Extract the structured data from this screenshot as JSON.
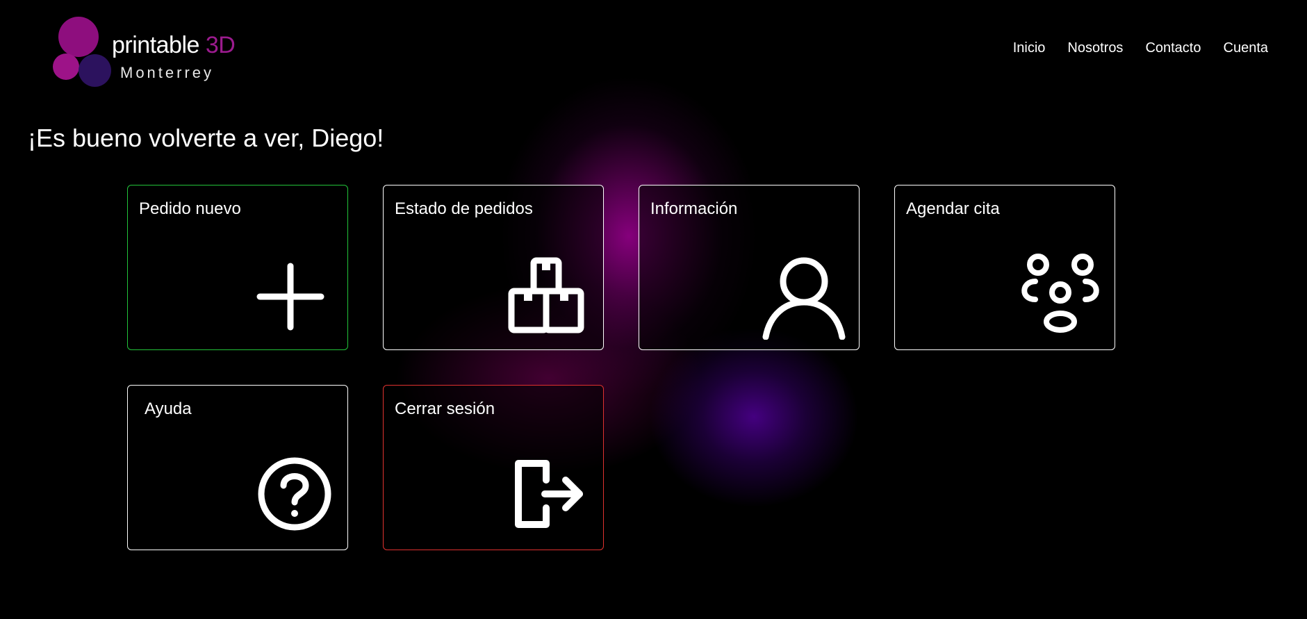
{
  "logo": {
    "brand_main": "printable",
    "brand_accent": "3D",
    "city": "Monterrey"
  },
  "nav": {
    "items": [
      "Inicio",
      "Nosotros",
      "Contacto",
      "Cuenta"
    ]
  },
  "greeting": "¡Es bueno volverte a ver, Diego!",
  "tiles": [
    {
      "label": "Pedido nuevo",
      "icon": "plus-icon",
      "border_color": "#22c43a"
    },
    {
      "label": "Estado de pedidos",
      "icon": "boxes-icon",
      "border_color": "#ffffff"
    },
    {
      "label": "Información",
      "icon": "person-icon",
      "border_color": "#ffffff"
    },
    {
      "label": "Agendar cita",
      "icon": "people-group-icon",
      "border_color": "#ffffff"
    },
    {
      "label": "Ayuda",
      "icon": "help-circle-icon",
      "border_color": "#ffffff"
    },
    {
      "label": "Cerrar sesión",
      "icon": "logout-icon",
      "border_color": "#e0322f"
    }
  ],
  "colors": {
    "background": "#000000",
    "brand_accent": "#9b1b8e",
    "glow_magenta": "#8c0082",
    "glow_violet": "#500096"
  }
}
